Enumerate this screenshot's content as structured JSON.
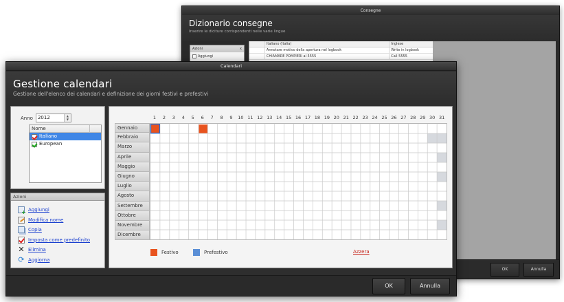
{
  "back_window": {
    "titlebar": "Consegne",
    "title": "Dizionario consegne",
    "subtitle": "Inserire le diciture corrispondenti nelle varie lingue",
    "sidebar": {
      "header": "Azioni",
      "header_close": "x",
      "first_item": "Aggiungi"
    },
    "table": {
      "columns": [
        "",
        "Italiano (Italia)",
        "Inglese"
      ],
      "rows": [
        [
          "",
          "Annotare motivo della apertura nel logbook",
          "Write in logbook"
        ],
        [
          "",
          "CHIAMARE POMPIERI al 5555",
          "Call 5555"
        ]
      ]
    },
    "footer": {
      "ok": "OK",
      "cancel": "Annulla"
    }
  },
  "front_window": {
    "titlebar": "Calendari",
    "title": "Gestione calendari",
    "subtitle": "Gestione dell'elenco dei calendari e definizione dei giorni festivi e prefestivi",
    "year_label": "Anno",
    "year_value": "2012",
    "list_header": "Nome",
    "calendars": [
      {
        "name": "Italiano",
        "selected": true,
        "icon": "red-check-icon"
      },
      {
        "name": "European",
        "selected": false,
        "icon": "green-check-icon"
      }
    ],
    "actions_header": "Azioni",
    "actions": [
      {
        "label": "Aggiungi",
        "icon": "add-calendar-icon"
      },
      {
        "label": "Modifica nome",
        "icon": "edit-icon"
      },
      {
        "label": "Copia",
        "icon": "copy-icon"
      },
      {
        "label": "Imposta come predefinito",
        "icon": "default-check-icon"
      },
      {
        "label": "Elimina",
        "icon": "delete-x-icon"
      },
      {
        "label": "Aggiorna",
        "icon": "refresh-icon"
      }
    ],
    "days": [
      "1",
      "2",
      "3",
      "4",
      "5",
      "6",
      "7",
      "8",
      "9",
      "10",
      "11",
      "12",
      "13",
      "14",
      "15",
      "16",
      "17",
      "18",
      "19",
      "20",
      "21",
      "22",
      "23",
      "24",
      "25",
      "26",
      "27",
      "28",
      "29",
      "30",
      "31"
    ],
    "months": [
      "Gennaio",
      "Febbraio",
      "Marzo",
      "Aprile",
      "Maggio",
      "Giugno",
      "Luglio",
      "Agosto",
      "Settembre",
      "Ottobre",
      "Novembre",
      "Dicembre"
    ],
    "month_lengths": [
      31,
      29,
      31,
      30,
      31,
      30,
      31,
      31,
      30,
      31,
      30,
      31
    ],
    "festivi": [
      {
        "month": 1,
        "day": 1
      },
      {
        "month": 1,
        "day": 6
      }
    ],
    "selected_cell": {
      "month": 1,
      "day": 1
    },
    "legend": {
      "festivo": "Festivo",
      "prefestivo": "Prefestivo",
      "reset": "Azzera"
    },
    "colors": {
      "festivo": "#e8531e",
      "prefestivo": "#5b8fd6",
      "selection": "#2e6fd6",
      "disabled": "#d6d9de"
    },
    "footer": {
      "ok": "OK",
      "cancel": "Annulla"
    }
  }
}
